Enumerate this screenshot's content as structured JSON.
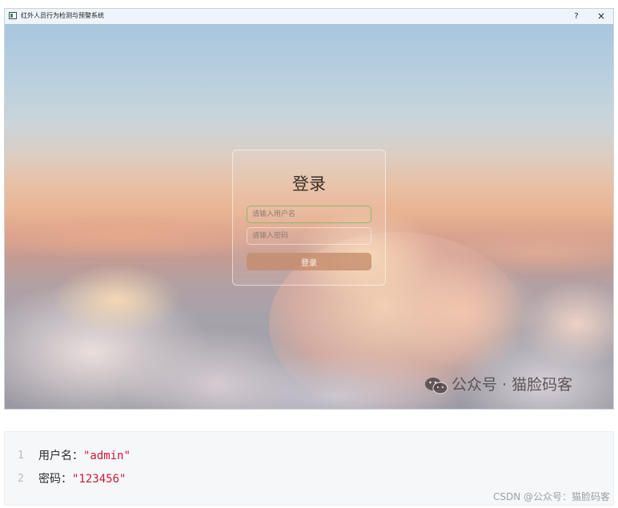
{
  "window": {
    "title": "红外人员行为检测与预警系统",
    "help_label": "?",
    "close_label": "×"
  },
  "login": {
    "title": "登录",
    "username_placeholder": "请输入用户名",
    "password_placeholder": "请输入密码",
    "button_label": "登录"
  },
  "watermark": {
    "icon": "wechat-icon",
    "text": "公众号 · 猫脸码客"
  },
  "code": {
    "lines": [
      {
        "number": "1",
        "key": "用户名：",
        "value": "\"admin\""
      },
      {
        "number": "2",
        "key": "密码：",
        "value": "\"123456\""
      }
    ],
    "footer": "CSDN @公众号：猫脸码客"
  },
  "colors": {
    "accent_focus": "#8fb86b",
    "string": "#c41a3a",
    "button": "#c48c6c"
  }
}
